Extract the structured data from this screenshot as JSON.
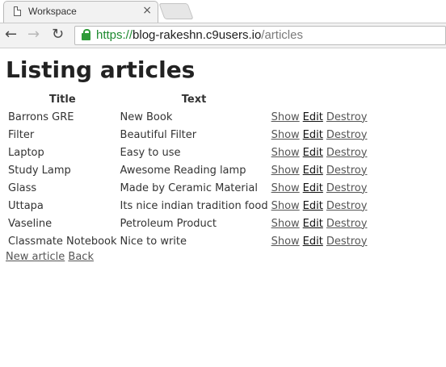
{
  "browser": {
    "tab_title": "Workspace",
    "tab_close": "×",
    "url_scheme": "https://",
    "url_host": "blog-rakeshn.c9users.io",
    "url_path": "/articles",
    "icons": {
      "back": "←",
      "forward": "→",
      "reload": "↻"
    }
  },
  "page": {
    "title": "Listing articles",
    "headers": [
      "Title",
      "Text"
    ],
    "rows": [
      {
        "title": "Barrons GRE",
        "text": "New Book"
      },
      {
        "title": "Filter",
        "text": "Beautiful Filter"
      },
      {
        "title": "Laptop",
        "text": "Easy to use"
      },
      {
        "title": "Study Lamp",
        "text": "Awesome Reading lamp"
      },
      {
        "title": "Glass",
        "text": "Made by Ceramic Material"
      },
      {
        "title": "Uttapa",
        "text": "Its nice indian tradition food"
      },
      {
        "title": "Vaseline",
        "text": "Petroleum Product"
      },
      {
        "title": "Classmate Notebook",
        "text": "Nice to write"
      }
    ],
    "actions": {
      "show": "Show",
      "edit": "Edit",
      "destroy": "Destroy"
    },
    "new_article": "New article",
    "back": "Back"
  }
}
